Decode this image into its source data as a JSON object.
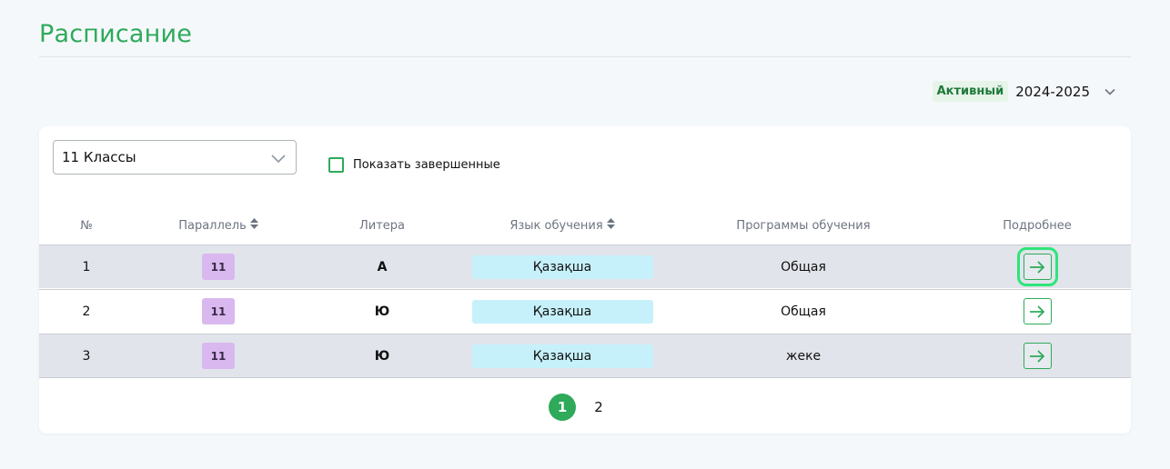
{
  "page": {
    "title": "Расписание"
  },
  "year": {
    "status": "Активный",
    "value": "2024-2025"
  },
  "filters": {
    "class_select": "11 Классы",
    "show_completed_label": "Показать завершенные",
    "show_completed_checked": false
  },
  "table": {
    "headers": {
      "num": "№",
      "parallel": "Параллель",
      "litera": "Литера",
      "language": "Язык обучения",
      "program": "Программы обучения",
      "details": "Подробнее"
    },
    "rows": [
      {
        "num": "1",
        "parallel": "11",
        "litera": "А",
        "language": "Қазақша",
        "program": "Общая"
      },
      {
        "num": "2",
        "parallel": "11",
        "litera": "Ю",
        "language": "Қазақша",
        "program": "Общая"
      },
      {
        "num": "3",
        "parallel": "11",
        "litera": "Ю",
        "language": "Қазақша",
        "program": "жеке"
      }
    ]
  },
  "pagination": {
    "pages": [
      "1",
      "2"
    ],
    "current": "1"
  },
  "colors": {
    "accent": "#2eaa5a",
    "grade_badge": "#d9b8ef",
    "language_badge": "#c6f1fb",
    "alt_row": "#e1e4ea",
    "focus_outline": "#2ee57a"
  },
  "icons": {
    "year_dropdown": "chevron-down-icon",
    "select_dropdown": "chevron-down-icon",
    "sort": "sort-icon",
    "details": "arrow-right-icon"
  }
}
